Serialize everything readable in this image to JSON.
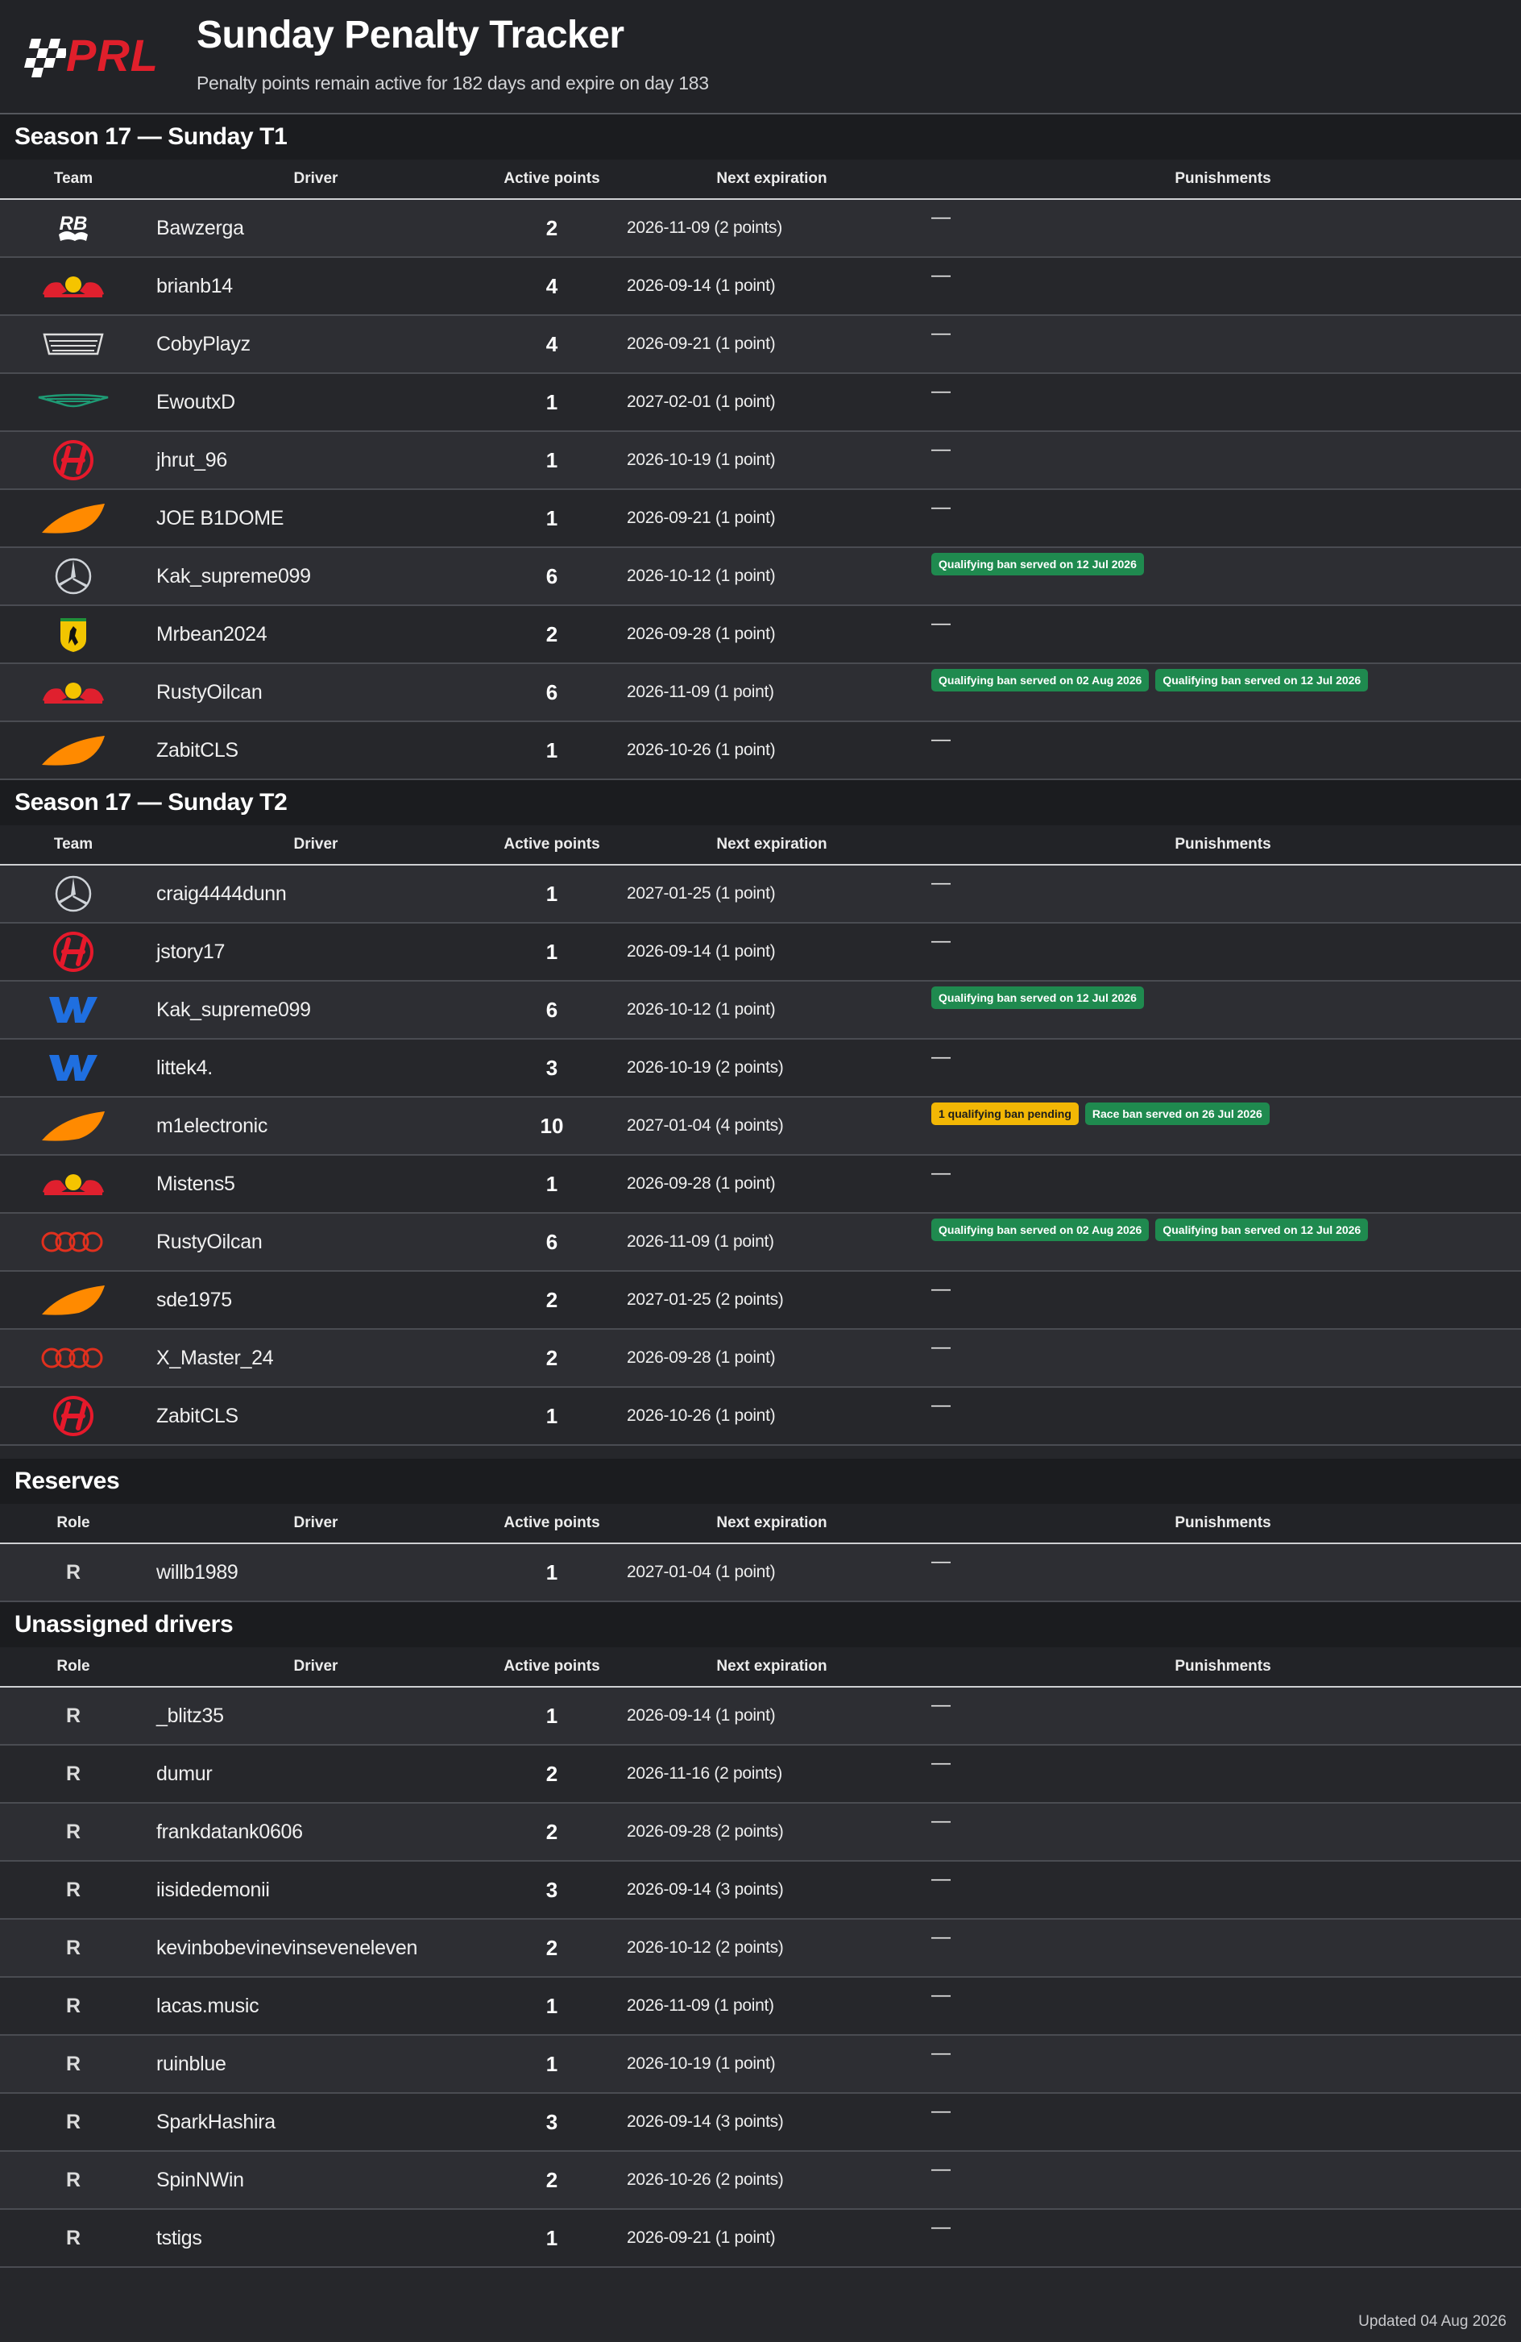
{
  "header": {
    "logo_text": "PRL",
    "title": "Sunday Penalty Tracker",
    "subtitle": "Penalty points remain active for 182 days and expire on day 183"
  },
  "columns_team": {
    "team": "Team",
    "driver": "Driver",
    "points": "Active points",
    "exp": "Next expiration",
    "pun": "Punishments"
  },
  "columns_role": {
    "team": "Role",
    "driver": "Driver",
    "points": "Active points",
    "exp": "Next expiration",
    "pun": "Punishments"
  },
  "colors": {
    "badge_green": "#1f8a4f",
    "badge_yellow": "#f2b705",
    "logo_red": "#e01f2b"
  },
  "sections": [
    {
      "title": "Season 17 — Sunday T1",
      "kind": "team",
      "rows": [
        {
          "team": "racing-bulls-icon",
          "driver": "Bawzerga",
          "points": "2",
          "exp": "2026-11-09 (2 points)",
          "pun": []
        },
        {
          "team": "red-bull-icon",
          "driver": "brianb14",
          "points": "4",
          "exp": "2026-09-14 (1 point)",
          "pun": []
        },
        {
          "team": "cadillac-icon",
          "driver": "CobyPlayz",
          "points": "4",
          "exp": "2026-09-21 (1 point)",
          "pun": []
        },
        {
          "team": "aston-martin-icon",
          "driver": "EwoutxD",
          "points": "1",
          "exp": "2027-02-01 (1 point)",
          "pun": []
        },
        {
          "team": "haas-icon",
          "driver": "jhrut_96",
          "points": "1",
          "exp": "2026-10-19 (1 point)",
          "pun": []
        },
        {
          "team": "mclaren-icon",
          "driver": "JOE B1DOME",
          "points": "1",
          "exp": "2026-09-21 (1 point)",
          "pun": []
        },
        {
          "team": "mercedes-icon",
          "driver": "Kak_supreme099",
          "points": "6",
          "exp": "2026-10-12 (1 point)",
          "pun": [
            {
              "text": "Qualifying ban served on 12 Jul 2026",
              "style": "green"
            }
          ]
        },
        {
          "team": "ferrari-icon",
          "driver": "Mrbean2024",
          "points": "2",
          "exp": "2026-09-28 (1 point)",
          "pun": []
        },
        {
          "team": "red-bull-icon",
          "driver": "RustyOilcan",
          "points": "6",
          "exp": "2026-11-09 (1 point)",
          "pun": [
            {
              "text": "Qualifying ban served on 02 Aug 2026",
              "style": "green"
            },
            {
              "text": "Qualifying ban served on 12 Jul 2026",
              "style": "green"
            }
          ]
        },
        {
          "team": "mclaren-icon",
          "driver": "ZabitCLS",
          "points": "1",
          "exp": "2026-10-26 (1 point)",
          "pun": []
        }
      ]
    },
    {
      "title": "Season 17 — Sunday T2",
      "kind": "team",
      "rows": [
        {
          "team": "mercedes-icon",
          "driver": "craig4444dunn",
          "points": "1",
          "exp": "2027-01-25 (1 point)",
          "pun": []
        },
        {
          "team": "haas-icon",
          "driver": "jstory17",
          "points": "1",
          "exp": "2026-09-14 (1 point)",
          "pun": []
        },
        {
          "team": "williams-icon",
          "driver": "Kak_supreme099",
          "points": "6",
          "exp": "2026-10-12 (1 point)",
          "pun": [
            {
              "text": "Qualifying ban served on 12 Jul 2026",
              "style": "green"
            }
          ]
        },
        {
          "team": "williams-icon",
          "driver": "littek4.",
          "points": "3",
          "exp": "2026-10-19 (2 points)",
          "pun": []
        },
        {
          "team": "mclaren-icon",
          "driver": "m1electronic",
          "points": "10",
          "exp": "2027-01-04 (4 points)",
          "pun": [
            {
              "text": "1 qualifying ban pending",
              "style": "yellow"
            },
            {
              "text": "Race ban served on 26 Jul 2026",
              "style": "green"
            }
          ]
        },
        {
          "team": "red-bull-icon",
          "driver": "Mistens5",
          "points": "1",
          "exp": "2026-09-28 (1 point)",
          "pun": []
        },
        {
          "team": "audi-icon",
          "driver": "RustyOilcan",
          "points": "6",
          "exp": "2026-11-09 (1 point)",
          "pun": [
            {
              "text": "Qualifying ban served on 02 Aug 2026",
              "style": "green"
            },
            {
              "text": "Qualifying ban served on 12 Jul 2026",
              "style": "green"
            }
          ]
        },
        {
          "team": "mclaren-icon",
          "driver": "sde1975",
          "points": "2",
          "exp": "2027-01-25 (2 points)",
          "pun": []
        },
        {
          "team": "audi-icon",
          "driver": "X_Master_24",
          "points": "2",
          "exp": "2026-09-28 (1 point)",
          "pun": []
        },
        {
          "team": "haas-icon",
          "driver": "ZabitCLS",
          "points": "1",
          "exp": "2026-10-26 (1 point)",
          "pun": []
        }
      ]
    },
    {
      "title": "Reserves",
      "kind": "role",
      "rows": [
        {
          "role": "R",
          "driver": "willb1989",
          "points": "1",
          "exp": "2027-01-04 (1 point)",
          "pun": []
        }
      ]
    },
    {
      "title": "Unassigned drivers",
      "kind": "role",
      "rows": [
        {
          "role": "R",
          "driver": "_blitz35",
          "points": "1",
          "exp": "2026-09-14 (1 point)",
          "pun": []
        },
        {
          "role": "R",
          "driver": "dumur",
          "points": "2",
          "exp": "2026-11-16 (2 points)",
          "pun": []
        },
        {
          "role": "R",
          "driver": "frankdatank0606",
          "points": "2",
          "exp": "2026-09-28 (2 points)",
          "pun": []
        },
        {
          "role": "R",
          "driver": "iisidedemonii",
          "points": "3",
          "exp": "2026-09-14 (3 points)",
          "pun": []
        },
        {
          "role": "R",
          "driver": "kevinbobevinevinseveneleven",
          "points": "2",
          "exp": "2026-10-12 (2 points)",
          "pun": []
        },
        {
          "role": "R",
          "driver": "lacas.music",
          "points": "1",
          "exp": "2026-11-09 (1 point)",
          "pun": []
        },
        {
          "role": "R",
          "driver": "ruinblue",
          "points": "1",
          "exp": "2026-10-19 (1 point)",
          "pun": []
        },
        {
          "role": "R",
          "driver": "SparkHashira",
          "points": "3",
          "exp": "2026-09-14 (3 points)",
          "pun": []
        },
        {
          "role": "R",
          "driver": "SpinNWin",
          "points": "2",
          "exp": "2026-10-26 (2 points)",
          "pun": []
        },
        {
          "role": "R",
          "driver": "tstigs",
          "points": "1",
          "exp": "2026-09-21 (1 point)",
          "pun": []
        }
      ]
    }
  ],
  "empty_punishment": "—",
  "footer": "Updated 04 Aug 2026"
}
